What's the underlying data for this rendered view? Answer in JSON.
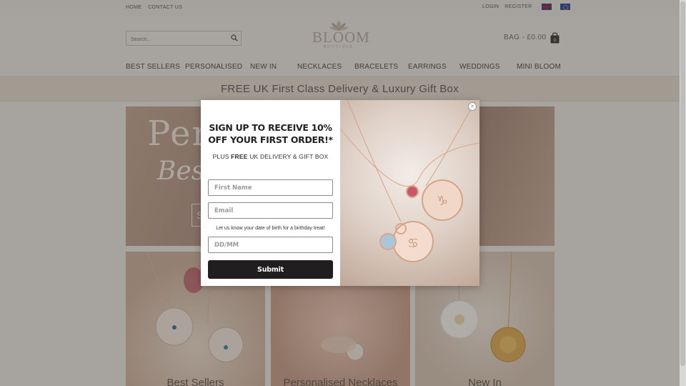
{
  "topbar": {
    "links": [
      "HOME",
      "CONTACT US"
    ],
    "login": "LOGIN",
    "register": "REGISTER",
    "flags": [
      "uk-flag-icon",
      "eu-flag-icon"
    ]
  },
  "header": {
    "search_placeholder": "Search...",
    "logo_text": "BLOOM",
    "logo_sub": "BOUTIQUE",
    "bag_label": "BAG - £0.00",
    "bag_count": "0"
  },
  "nav": {
    "items": [
      "BEST SELLERS",
      "PERSONALISED",
      "NEW IN",
      "NECKLACES",
      "BRACELETS",
      "EARRINGS",
      "WEDDINGS",
      "MINI BLOOM"
    ]
  },
  "promo": {
    "text": "FREE UK First Class Delivery & Luxury Gift Box"
  },
  "hero": {
    "line1": "Pers",
    "line2": "Bes",
    "cta": "S"
  },
  "tiles": [
    {
      "caption": "Best Sellers"
    },
    {
      "caption": "Personalised Necklaces"
    },
    {
      "caption": "New In"
    }
  ],
  "modal": {
    "headline_1": "SIGN UP TO RECEIVE 10%",
    "headline_2": "OFF YOUR FIRST ORDER!*",
    "sub_prefix": "PLUS ",
    "sub_bold": "FREE",
    "sub_suffix": " UK DELIVERY & GIFT BOX",
    "first_name_placeholder": "First Name",
    "email_placeholder": "Email",
    "birthday_note": "Let us know your date of birth for a birthday treat!",
    "dob_placeholder": "DD/MM",
    "submit_label": "Submit",
    "close_glyph": "×"
  },
  "colors": {
    "accent": "#b2a79e",
    "promo_bg": "#e1d9ce",
    "submit_bg": "#201e1e"
  }
}
